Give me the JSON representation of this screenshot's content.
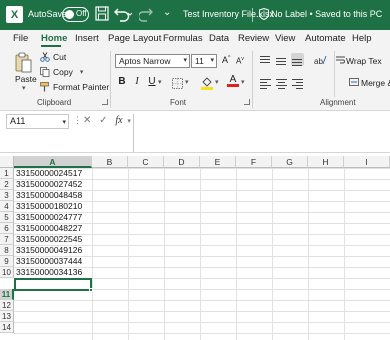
{
  "titlebar": {
    "app_icon_letter": "X",
    "autosave_label": "AutoSave",
    "autosave_state": "Off",
    "file_title": "Test Inventory File.xlsx",
    "sensitivity_label": "No Label",
    "save_status": "Saved to this PC",
    "save_status_combined": "No Label • Saved to this PC",
    "more_glyph": "⌄"
  },
  "tabs": [
    "File",
    "Home",
    "Insert",
    "Page Layout",
    "Formulas",
    "Data",
    "Review",
    "View",
    "Automate",
    "Help"
  ],
  "active_tab": "Home",
  "ribbon": {
    "clipboard": {
      "paste_label": "Paste",
      "cut_label": "Cut",
      "copy_label": "Copy",
      "format_painter_label": "Format Painter",
      "group_label": "Clipboard"
    },
    "font": {
      "font_name": "Aptos Narrow",
      "font_size": "11",
      "bold": "B",
      "italic": "I",
      "underline": "U",
      "group_label": "Font"
    },
    "alignment": {
      "wrap_text_label": "Wrap Tex",
      "merge_label": "Merge &",
      "group_label": "Alignment"
    }
  },
  "formula_bar": {
    "name_box": "A11",
    "fx": "fx",
    "formula": ""
  },
  "grid": {
    "columns": [
      "A",
      "B",
      "C",
      "D",
      "E",
      "F",
      "G",
      "H",
      "I"
    ],
    "rows": [
      "1",
      "2",
      "3",
      "4",
      "5",
      "6",
      "7",
      "8",
      "9",
      "10",
      "11",
      "12",
      "13",
      "14"
    ],
    "selected_column": "A",
    "selected_row": "11",
    "cells_A": [
      "33150000024517",
      "33150000027452",
      "33150000048458",
      "33150000180210",
      "33150000024777",
      "33150000048227",
      "33150000022545",
      "33150000049126",
      "33150000037444",
      "33150000034136"
    ]
  },
  "colors": {
    "accent": "#1e7145",
    "ribbon_bg": "#f3f3f3",
    "grid_line": "#e1e1e1"
  }
}
